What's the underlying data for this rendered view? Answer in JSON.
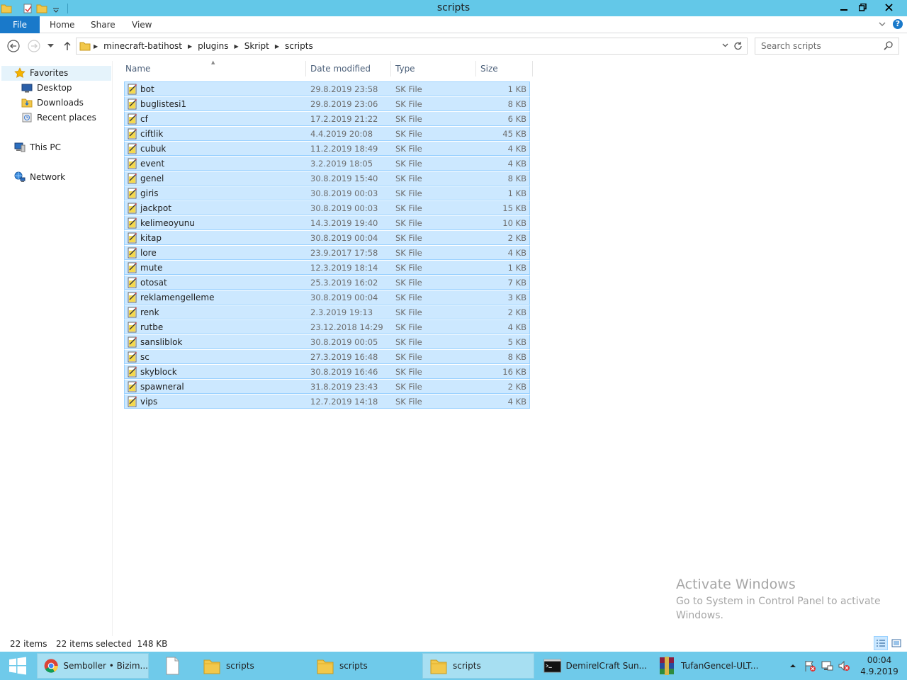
{
  "window": {
    "title": "scripts",
    "controls": [
      "minimize",
      "restore",
      "close"
    ]
  },
  "ribbon": {
    "tabs": [
      "File",
      "Home",
      "Share",
      "View"
    ]
  },
  "address": {
    "crumbs": [
      "minecraft-batihost",
      "plugins",
      "Skript",
      "scripts"
    ]
  },
  "search": {
    "placeholder": "Search scripts"
  },
  "nav_pane": {
    "favorites": "Favorites",
    "favorite_items": [
      "Desktop",
      "Downloads",
      "Recent places"
    ],
    "this_pc": "This PC",
    "network": "Network"
  },
  "columns": [
    "Name",
    "Date modified",
    "Type",
    "Size"
  ],
  "files": [
    {
      "name": "bot",
      "date": "29.8.2019 23:58",
      "type": "SK File",
      "size": "1 KB"
    },
    {
      "name": "buglistesi1",
      "date": "29.8.2019 23:06",
      "type": "SK File",
      "size": "8 KB"
    },
    {
      "name": "cf",
      "date": "17.2.2019 21:22",
      "type": "SK File",
      "size": "6 KB"
    },
    {
      "name": "ciftlik",
      "date": "4.4.2019 20:08",
      "type": "SK File",
      "size": "45 KB"
    },
    {
      "name": "cubuk",
      "date": "11.2.2019 18:49",
      "type": "SK File",
      "size": "4 KB"
    },
    {
      "name": "event",
      "date": "3.2.2019 18:05",
      "type": "SK File",
      "size": "4 KB"
    },
    {
      "name": "genel",
      "date": "30.8.2019 15:40",
      "type": "SK File",
      "size": "8 KB"
    },
    {
      "name": "giris",
      "date": "30.8.2019 00:03",
      "type": "SK File",
      "size": "1 KB"
    },
    {
      "name": "jackpot",
      "date": "30.8.2019 00:03",
      "type": "SK File",
      "size": "15 KB"
    },
    {
      "name": "kelimeoyunu",
      "date": "14.3.2019 19:40",
      "type": "SK File",
      "size": "10 KB"
    },
    {
      "name": "kitap",
      "date": "30.8.2019 00:04",
      "type": "SK File",
      "size": "2 KB"
    },
    {
      "name": "lore",
      "date": "23.9.2017 17:58",
      "type": "SK File",
      "size": "4 KB"
    },
    {
      "name": "mute",
      "date": "12.3.2019 18:14",
      "type": "SK File",
      "size": "1 KB"
    },
    {
      "name": "otosat",
      "date": "25.3.2019 16:02",
      "type": "SK File",
      "size": "7 KB"
    },
    {
      "name": "reklamengelleme",
      "date": "30.8.2019 00:04",
      "type": "SK File",
      "size": "3 KB"
    },
    {
      "name": "renk",
      "date": "2.3.2019 19:13",
      "type": "SK File",
      "size": "2 KB"
    },
    {
      "name": "rutbe",
      "date": "23.12.2018 14:29",
      "type": "SK File",
      "size": "4 KB"
    },
    {
      "name": "sansliblok",
      "date": "30.8.2019 00:05",
      "type": "SK File",
      "size": "5 KB"
    },
    {
      "name": "sc",
      "date": "27.3.2019 16:48",
      "type": "SK File",
      "size": "8 KB"
    },
    {
      "name": "skyblock",
      "date": "30.8.2019 16:46",
      "type": "SK File",
      "size": "16 KB"
    },
    {
      "name": "spawneral",
      "date": "31.8.2019 23:43",
      "type": "SK File",
      "size": "2 KB"
    },
    {
      "name": "vips",
      "date": "12.7.2019 14:18",
      "type": "SK File",
      "size": "4 KB"
    }
  ],
  "status": {
    "items": "22 items",
    "selected": "22 items selected  148 KB"
  },
  "watermark": {
    "title": "Activate Windows",
    "subtitle": "Go to System in Control Panel to activate Windows."
  },
  "taskbar": {
    "buttons": [
      {
        "label": "Semboller • Bizim...",
        "icon": "chrome-icon",
        "active": true
      },
      {
        "label": "",
        "icon": "notepad-icon",
        "active": false
      },
      {
        "label": "scripts",
        "icon": "folder-icon",
        "active": false
      },
      {
        "label": "scripts",
        "icon": "folder-icon",
        "active": false
      },
      {
        "label": "scripts",
        "icon": "folder-icon",
        "active": true
      },
      {
        "label": "DemirelCraft Sun...",
        "icon": "cmd-icon",
        "active": false
      },
      {
        "label": "TufanGencel-ULT...",
        "icon": "winrar-icon",
        "active": false
      }
    ],
    "time": "00:04",
    "date": "4.9.2019"
  },
  "colors": {
    "titlebar": "#63c8e8",
    "file_tab": "#1979ca",
    "selection": "#cce8ff",
    "taskbar": "#6fcaea"
  }
}
